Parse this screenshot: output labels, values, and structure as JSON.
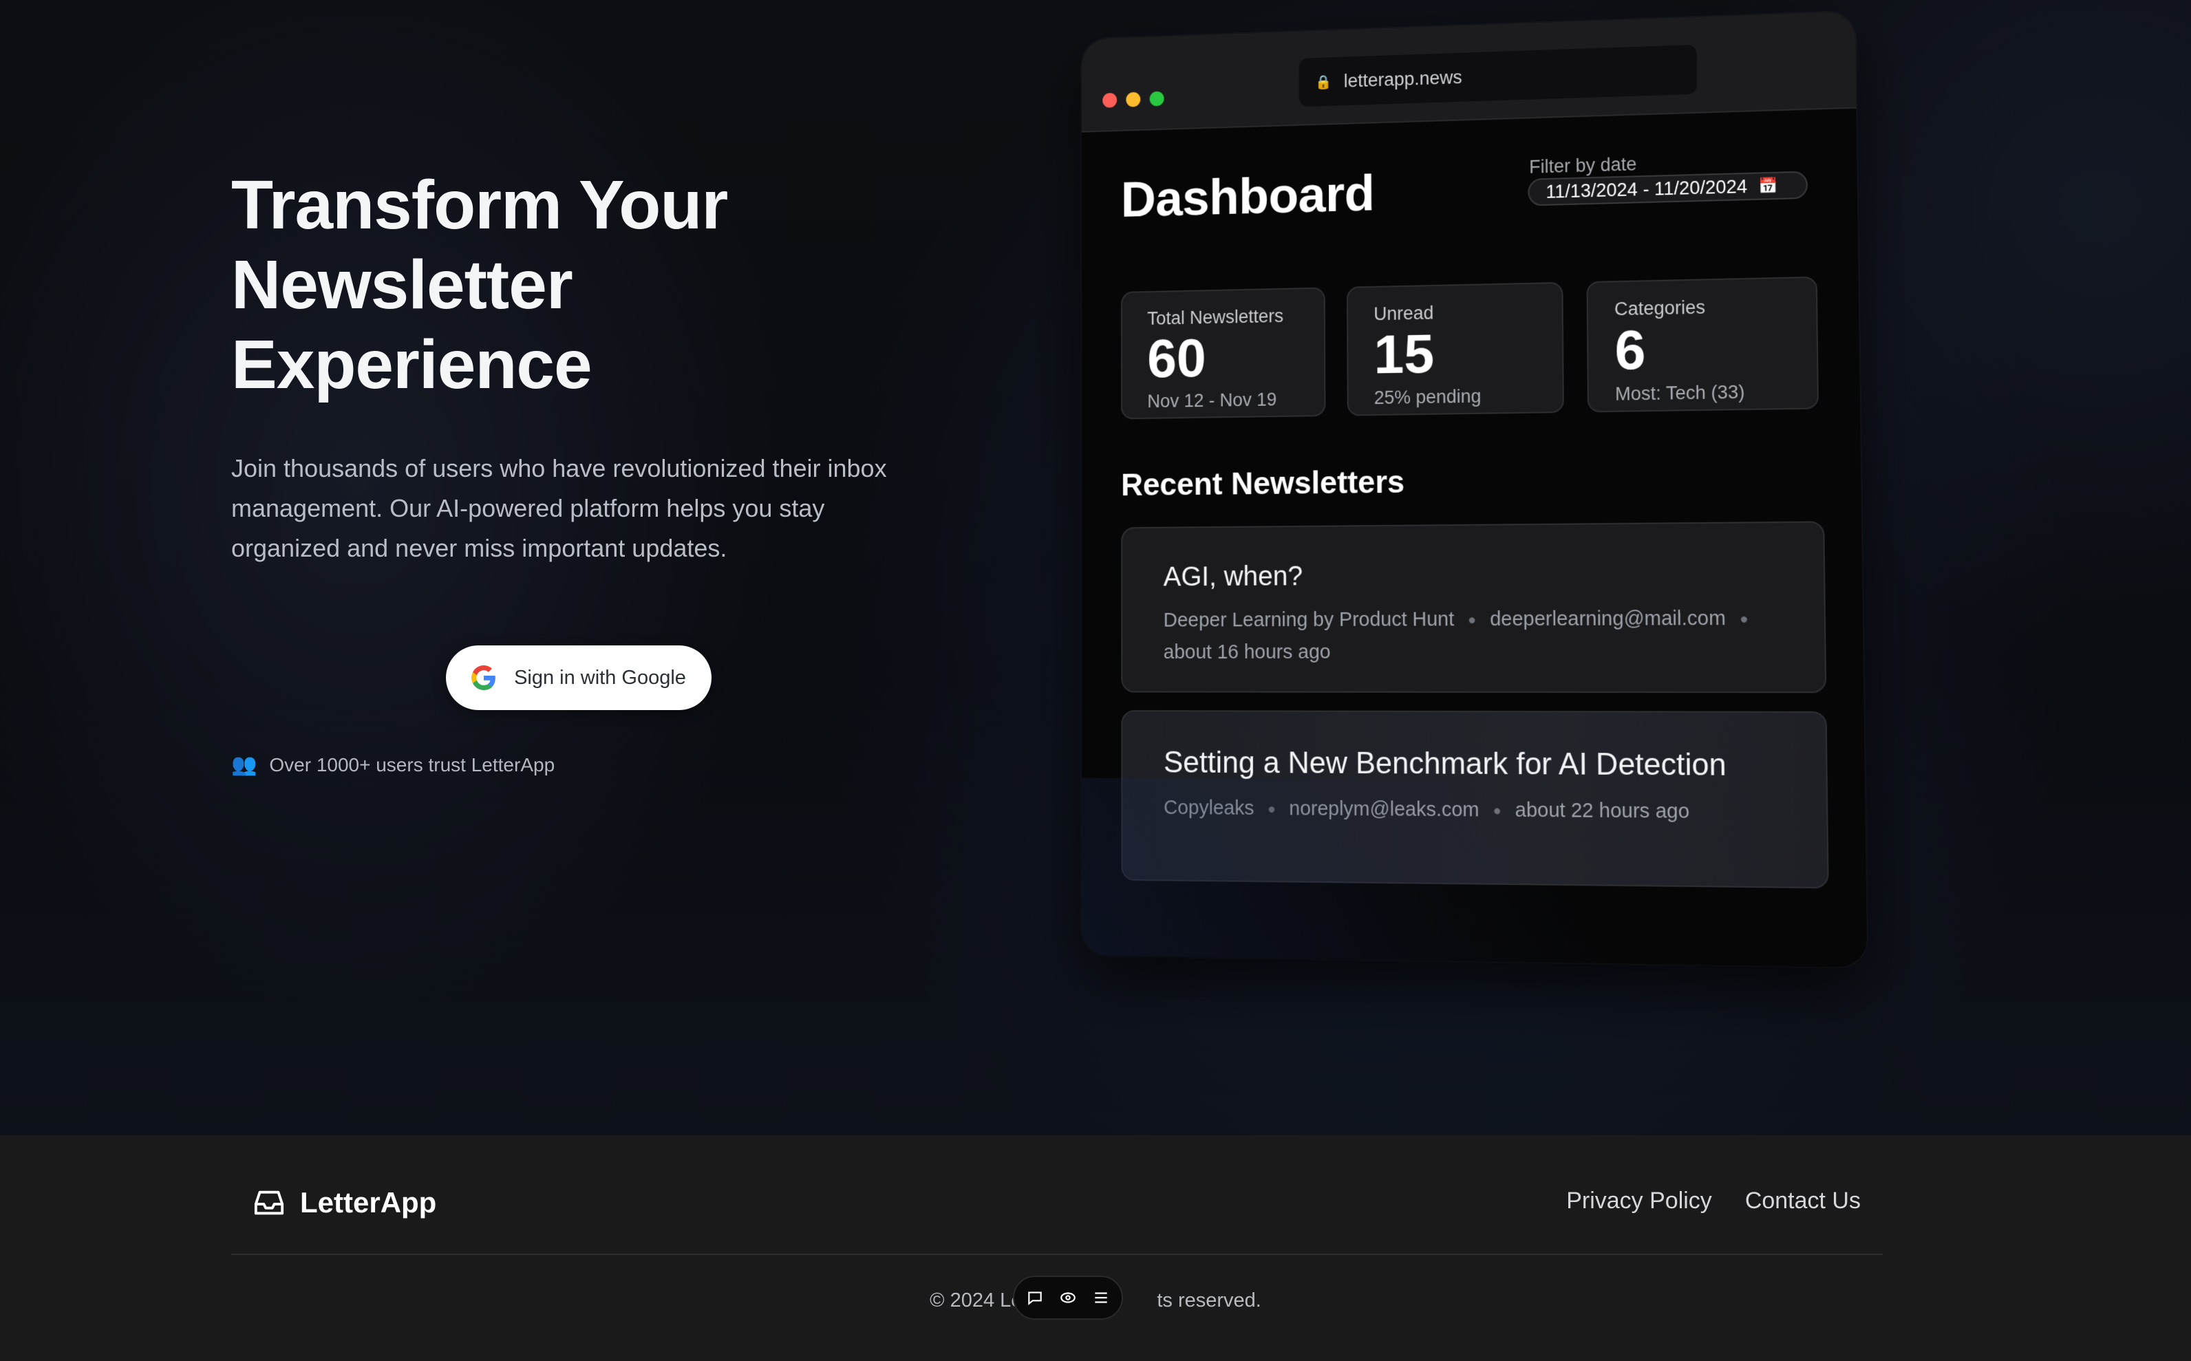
{
  "hero": {
    "title_lines": [
      "Transform Your",
      "Newsletter",
      "Experience"
    ],
    "subtitle": "Join thousands of users who have revolutionized their inbox management. Our AI-powered platform helps you stay organized and never miss important updates.",
    "google_button_label": "Sign in with Google",
    "trust_text": "Over 1000+ users trust LetterApp"
  },
  "mockup": {
    "url": "letterapp.news",
    "dashboard_title": "Dashboard",
    "filter_label": "Filter by date",
    "filter_value": "11/13/2024 - 11/20/2024",
    "stats": [
      {
        "label": "Total Newsletters",
        "value": "60",
        "sub": "Nov 12 - Nov 19"
      },
      {
        "label": "Unread",
        "value": "15",
        "sub": "25% pending"
      },
      {
        "label": "Categories",
        "value": "6",
        "sub": "Most: Tech (33)"
      }
    ],
    "recent_title": "Recent Newsletters",
    "newsletters": [
      {
        "title": "AGI, when?",
        "source": "Deeper Learning by Product Hunt",
        "email": "deeperlearning@mail.com",
        "time": "about 16 hours ago"
      },
      {
        "title": "Setting a New Benchmark for AI Detection",
        "source": "Copyleaks",
        "email": "noreplym@leaks.com",
        "time": "about 22 hours ago"
      }
    ]
  },
  "footer": {
    "brand": "LetterApp",
    "links": [
      "Privacy Policy",
      "Contact Us"
    ],
    "copyright_left": "© 2024 Letter",
    "copyright_right": "ts reserved."
  },
  "colors": {
    "accent_red": "#ff5f57",
    "accent_yellow": "#febc2e",
    "accent_green": "#28c840",
    "footer_bg": "#1a1a1a"
  }
}
